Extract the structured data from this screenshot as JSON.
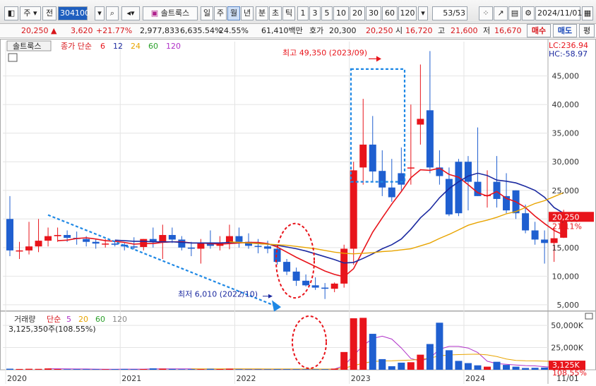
{
  "toolbar": {
    "period_type": "주",
    "prefix_label": "전",
    "code": "304100",
    "name": "솔트룩스",
    "periods": [
      "일",
      "주",
      "월",
      "년"
    ],
    "active_period": "월",
    "intraday": [
      "분",
      "초",
      "틱"
    ],
    "minutes": [
      "1",
      "3",
      "5",
      "10",
      "20",
      "30",
      "60",
      "120"
    ],
    "page_count": "53",
    "page_total": "/53",
    "date": "2024/11/01"
  },
  "quote": {
    "price": "20,250",
    "change_arrow": "▲",
    "change": "3,620",
    "change_pct": "+21.77%",
    "volume": "2,977,833",
    "volume_ratio": "6,635.54%",
    "turnover": "24.55%",
    "amount": "61,410백만",
    "ask_label": "호가",
    "ask": "20,300",
    "bid": "20,250",
    "open_label": "시",
    "open": "16,720",
    "high_label": "고",
    "high": "21,600",
    "low_label": "저",
    "low": "16,670",
    "buy_label": "매수",
    "sell_label": "매도",
    "extra_label": "평"
  },
  "price_panel": {
    "stock_label": "솔트룩스",
    "ma_title": "종가 단순",
    "ma_periods": [
      "6",
      "12",
      "24",
      "60",
      "120"
    ],
    "lc": "LC:236.94",
    "hc": "HC:-58.97",
    "last_price_tag": "20,250",
    "last_pct_tag": "21.11%",
    "annot_high": "최고 49,350 (2023/09)",
    "annot_low": "최저 6,010 (2022/10)"
  },
  "volume_panel": {
    "title": "거래량",
    "ma_title": "단순",
    "ma_periods": [
      "5",
      "20",
      "60",
      "120"
    ],
    "current": "3,125,350주(108.55%)",
    "last_tag": "3,125K",
    "last_pct_tag": "108.55%"
  },
  "colors": {
    "up": "#e8141b",
    "down": "#1f5fd0",
    "ma6": "#e8141b",
    "ma12": "#1c2aa0",
    "ma24": "#e8a400",
    "ma60": "#2aa02a",
    "ma120": "#b030c8",
    "annotation_blue": "#1e88e5",
    "annotation_red": "#e8141b"
  },
  "chart_data": {
    "type": "candlestick",
    "x": [
      "2020-01",
      "2020-02",
      "2020-03",
      "2020-04",
      "2020-05",
      "2020-06",
      "2020-07",
      "2020-08",
      "2020-09",
      "2020-10",
      "2020-11",
      "2020-12",
      "2021-01",
      "2021-02",
      "2021-03",
      "2021-04",
      "2021-05",
      "2021-06",
      "2021-07",
      "2021-08",
      "2021-09",
      "2021-10",
      "2021-11",
      "2021-12",
      "2022-01",
      "2022-02",
      "2022-03",
      "2022-04",
      "2022-05",
      "2022-06",
      "2022-07",
      "2022-08",
      "2022-09",
      "2022-10",
      "2022-11",
      "2022-12",
      "2023-01",
      "2023-02",
      "2023-03",
      "2023-04",
      "2023-05",
      "2023-06",
      "2023-07",
      "2023-08",
      "2023-09",
      "2023-10",
      "2023-11",
      "2023-12",
      "2024-01",
      "2024-02",
      "2024-03",
      "2024-04",
      "2024-05",
      "2024-06",
      "2024-07",
      "2024-08",
      "2024-09",
      "2024-10",
      "2024-11"
    ],
    "open": [
      20000,
      14500,
      14500,
      15200,
      16200,
      17000,
      17200,
      16700,
      16500,
      16000,
      15700,
      15700,
      15500,
      15200,
      15100,
      16500,
      16000,
      17200,
      16400,
      15000,
      14800,
      15900,
      15300,
      15800,
      17000,
      16000,
      15300,
      15200,
      14800,
      12500,
      10800,
      9200,
      8400,
      8000,
      7800,
      8700,
      14800,
      29000,
      33000,
      28400,
      25500,
      28000,
      29000,
      36500,
      39000,
      29000,
      27000,
      30000,
      30000,
      26500,
      24000,
      26500,
      24000,
      25000,
      21000,
      18000,
      16400,
      15800,
      16720
    ],
    "high": [
      24000,
      16000,
      19500,
      20000,
      18500,
      18500,
      18000,
      17800,
      17000,
      16500,
      16500,
      16200,
      15800,
      16800,
      16500,
      18500,
      19000,
      18500,
      17000,
      16000,
      16500,
      18000,
      17000,
      19000,
      18500,
      17500,
      16500,
      16200,
      15500,
      13000,
      11500,
      10300,
      9800,
      8800,
      8900,
      15500,
      30000,
      41000,
      38000,
      32000,
      30500,
      32500,
      40000,
      47000,
      49350,
      32000,
      29000,
      30500,
      31000,
      36000,
      28500,
      31000,
      28000,
      25000,
      22500,
      19500,
      18000,
      18600,
      21600
    ],
    "low": [
      13500,
      13000,
      13800,
      14200,
      15200,
      16000,
      16000,
      15500,
      15200,
      14800,
      15000,
      15200,
      14500,
      14700,
      14500,
      15000,
      13000,
      15800,
      14500,
      13500,
      12200,
      14800,
      14500,
      14700,
      15000,
      14800,
      14000,
      14000,
      12000,
      10200,
      8300,
      8200,
      7600,
      6010,
      7200,
      8000,
      12000,
      26000,
      26500,
      24000,
      23000,
      25000,
      26000,
      33000,
      28000,
      26000,
      20500,
      20500,
      21500,
      24000,
      22000,
      22000,
      21000,
      20000,
      17500,
      15500,
      12200,
      12500,
      16670
    ],
    "close": [
      14500,
      14500,
      15200,
      16200,
      17000,
      17200,
      16700,
      16500,
      16000,
      15700,
      15700,
      15500,
      15200,
      15100,
      16500,
      16000,
      17200,
      16400,
      15000,
      14800,
      15900,
      15300,
      15800,
      17000,
      16000,
      15300,
      15200,
      14800,
      12500,
      10800,
      9200,
      8400,
      8000,
      7800,
      8700,
      14800,
      28500,
      33000,
      28300,
      25500,
      23800,
      26000,
      29000,
      37500,
      29000,
      27500,
      20800,
      21000,
      26500,
      24000,
      24200,
      23500,
      21500,
      21000,
      18000,
      16400,
      15800,
      16630,
      20250
    ],
    "ma_series": [
      {
        "period": "6",
        "values": [
          null,
          null,
          null,
          null,
          null,
          16200,
          16300,
          16600,
          16700,
          16500,
          16200,
          16100,
          15900,
          15600,
          15700,
          15700,
          15900,
          16000,
          16000,
          15800,
          15800,
          15700,
          15600,
          15700,
          15800,
          15900,
          15900,
          15700,
          15100,
          14200,
          13300,
          12500,
          11700,
          10900,
          10300,
          9900,
          11300,
          14500,
          17700,
          20200,
          22600,
          24800,
          27200,
          28600,
          28500,
          28900,
          27800,
          27300,
          26000,
          24600,
          24000,
          24800,
          23600,
          23000,
          22000,
          20500,
          19200,
          18000,
          17200
        ]
      },
      {
        "period": "12",
        "values": [
          null,
          null,
          null,
          null,
          null,
          null,
          null,
          null,
          null,
          null,
          null,
          16300,
          16200,
          16100,
          16100,
          16000,
          16000,
          16000,
          15900,
          15800,
          15800,
          15800,
          15800,
          15900,
          15900,
          15800,
          15700,
          15600,
          15400,
          15100,
          14800,
          14400,
          13900,
          13400,
          12900,
          12300,
          12400,
          13100,
          13900,
          14800,
          15500,
          16500,
          18200,
          20200,
          21700,
          23700,
          25300,
          26500,
          27500,
          28000,
          27600,
          26800,
          26600,
          26300,
          25700,
          25000,
          23800,
          22000,
          21000
        ]
      },
      {
        "period": "24",
        "values": [
          null,
          null,
          null,
          null,
          null,
          null,
          null,
          null,
          null,
          null,
          null,
          null,
          null,
          null,
          null,
          null,
          null,
          null,
          null,
          null,
          null,
          null,
          null,
          16000,
          15900,
          15800,
          15700,
          15600,
          15500,
          15400,
          15200,
          15000,
          14800,
          14500,
          14200,
          14000,
          13900,
          14000,
          14100,
          14300,
          14400,
          14600,
          14800,
          15300,
          15800,
          16600,
          17300,
          18100,
          18900,
          19400,
          19800,
          20300,
          20900,
          21300,
          22000,
          22700,
          23200,
          23900,
          24600
        ]
      },
      {
        "period": "60",
        "values": []
      },
      {
        "period": "120",
        "values": []
      }
    ],
    "volume": [
      1200,
      900,
      1100,
      1000,
      1500,
      800,
      600,
      700,
      650,
      600,
      550,
      700,
      900,
      650,
      800,
      1600,
      1300,
      900,
      600,
      700,
      650,
      1100,
      800,
      1200,
      600,
      500,
      550,
      600,
      750,
      700,
      650,
      600,
      600,
      650,
      1300,
      20000,
      58000,
      58500,
      40500,
      12000,
      4000,
      8000,
      8500,
      17000,
      29000,
      53000,
      22000,
      10000,
      7500,
      5000,
      3500,
      9000,
      5500,
      3500,
      2000,
      2200,
      2500,
      2100,
      3125
    ],
    "volume_ma5": [
      null,
      null,
      null,
      null,
      1100,
      1100,
      1000,
      900,
      900,
      700,
      600,
      640,
      700,
      700,
      720,
      930,
      1050,
      1050,
      1040,
      1020,
      830,
      790,
      770,
      850,
      840,
      770,
      740,
      690,
      640,
      620,
      650,
      670,
      660,
      660,
      780,
      4630,
      16120,
      27270,
      35270,
      37800,
      34600,
      24600,
      12600,
      9900,
      13300,
      23100,
      26300,
      26300,
      24500,
      19500,
      9600,
      7000,
      6100,
      5300,
      4700,
      4400,
      3500,
      2700,
      2400
    ],
    "volume_ma20": [
      null,
      null,
      null,
      null,
      null,
      null,
      null,
      null,
      null,
      null,
      null,
      null,
      null,
      null,
      null,
      null,
      null,
      null,
      null,
      1000,
      980,
      990,
      980,
      1000,
      960,
      940,
      920,
      900,
      870,
      850,
      850,
      840,
      830,
      810,
      840,
      1800,
      4600,
      7400,
      9400,
      9900,
      10100,
      10500,
      10900,
      11700,
      13100,
      15700,
      16700,
      17100,
      17400,
      17600,
      16800,
      14900,
      12200,
      10500,
      10100,
      10000,
      9700,
      9300,
      8200
    ],
    "ylim": [
      4000,
      51000
    ],
    "yticks": [
      5000,
      10000,
      15000,
      20000,
      25000,
      30000,
      35000,
      40000,
      45000
    ],
    "ytick_labels": [
      "5,000",
      "10,000",
      "15,000",
      "20,000",
      "25,000",
      "30,000",
      "35,000",
      "40,000",
      "45,000"
    ],
    "volume_ylim": [
      0,
      62000
    ],
    "volume_yticks": [
      25000,
      50000
    ],
    "volume_ytick_labels": [
      "25,000K",
      "50,000K"
    ],
    "xtick_labels": [
      "2020",
      "2021",
      "2022",
      "2023",
      "2024",
      "11/01"
    ],
    "xtick_index": [
      0,
      12,
      24,
      36,
      48,
      58
    ]
  }
}
